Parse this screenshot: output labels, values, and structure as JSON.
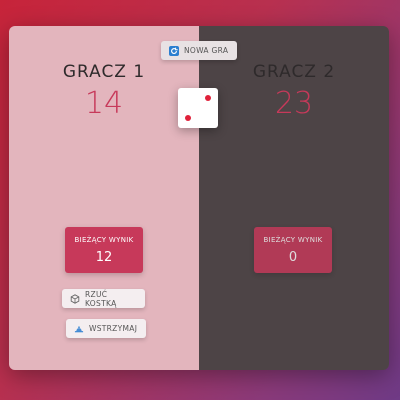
{
  "game": {
    "new_game_label": "NOWA GRA",
    "roll_label": "RZUĆ KOSTKĄ",
    "hold_label": "WSTRZYMAJ",
    "dice_value": 2
  },
  "players": [
    {
      "name": "GRACZ 1",
      "score": "14",
      "current_label": "BIEŻĄCY WYNIK",
      "current": "12",
      "active": true
    },
    {
      "name": "GRACZ 2",
      "score": "23",
      "current_label": "BIEŻĄCY WYNIK",
      "current": "0",
      "active": false
    }
  ],
  "colors": {
    "accent": "#c7395a",
    "active_panel": "#e3b5bd",
    "inactive_panel": "#4d4446",
    "dice_pip": "#e0213a"
  },
  "icons": {
    "new_game": "refresh-icon",
    "roll": "dice-icon",
    "hold": "hand-icon"
  }
}
